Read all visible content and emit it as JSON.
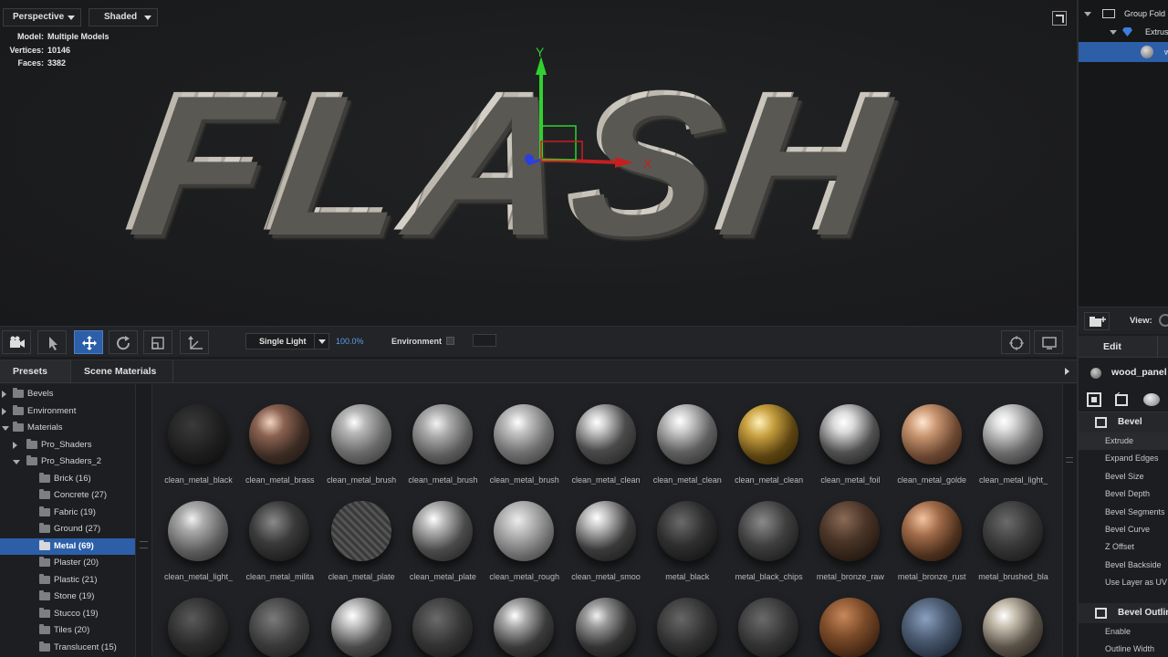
{
  "viewport": {
    "camera_mode": "Perspective",
    "shading_mode": "Shaded",
    "stats": [
      {
        "key": "Model:",
        "value": "Multiple Models"
      },
      {
        "key": "Vertices:",
        "value": "10146"
      },
      {
        "key": "Faces:",
        "value": "3382"
      }
    ],
    "model_text": "FLASH",
    "gizmo": {
      "y_label": "Y",
      "x_label": "X"
    }
  },
  "toolbar": {
    "light_mode": "Single Light",
    "light_intensity": "100.0%",
    "environment_label": "Environment",
    "tools": [
      "camera-icon",
      "select-arrow-icon",
      "move-icon",
      "rotate-icon",
      "scale-icon",
      "axis-icon"
    ],
    "active_tool": "move-icon"
  },
  "presets": {
    "tabs": [
      "Presets",
      "Scene Materials"
    ],
    "tree": [
      {
        "label": "Bevels",
        "level": 0,
        "arrow": "right"
      },
      {
        "label": "Environment",
        "level": 0,
        "arrow": "right"
      },
      {
        "label": "Materials",
        "level": 0,
        "arrow": "down"
      },
      {
        "label": "Pro_Shaders",
        "level": 1,
        "arrow": "right"
      },
      {
        "label": "Pro_Shaders_2",
        "level": 1,
        "arrow": "down"
      },
      {
        "label": "Brick (16)",
        "level": 2
      },
      {
        "label": "Concrete (27)",
        "level": 2
      },
      {
        "label": "Fabric (19)",
        "level": 2
      },
      {
        "label": "Ground (27)",
        "level": 2
      },
      {
        "label": "Metal (69)",
        "level": 2,
        "selected": true
      },
      {
        "label": "Plaster (20)",
        "level": 2
      },
      {
        "label": "Plastic (21)",
        "level": 2
      },
      {
        "label": "Stone (19)",
        "level": 2
      },
      {
        "label": "Stucco (19)",
        "level": 2
      },
      {
        "label": "Tiles (20)",
        "level": 2
      },
      {
        "label": "Translucent (15)",
        "level": 2
      }
    ],
    "materials_row1": [
      "clean_metal_black",
      "clean_metal_brass",
      "clean_metal_brush",
      "clean_metal_brush",
      "clean_metal_brush",
      "clean_metal_clean",
      "clean_metal_clean",
      "clean_metal_clean",
      "clean_metal_foil",
      "clean_metal_golde",
      "clean_metal_light_"
    ],
    "materials_row2": [
      "clean_metal_light_",
      "clean_metal_milita",
      "clean_metal_plate",
      "clean_metal_plate",
      "clean_metal_rough",
      "clean_metal_smoo",
      "metal_black",
      "metal_black_chips",
      "metal_bronze_raw",
      "metal_bronze_rust",
      "metal_brushed_bla"
    ]
  },
  "scene": {
    "rows": [
      {
        "label": "Group Fold",
        "indent": 1
      },
      {
        "label": "Extrus",
        "indent": 2
      },
      {
        "label": "w",
        "indent": 3,
        "selected": true
      }
    ],
    "view_label": "View:",
    "edit_tab": "Edit",
    "material_name": "wood_panel",
    "sections": [
      {
        "title": "Bevel",
        "props": [
          "Extrude",
          "Expand Edges",
          "Bevel Size",
          "Bevel Depth",
          "Bevel Segments",
          "Bevel Curve",
          "Z Offset",
          "Bevel Backside",
          "Use Layer as UV"
        ]
      },
      {
        "title": "Bevel Outline",
        "props": [
          "Enable",
          "Outline Width"
        ]
      }
    ]
  },
  "colors": {
    "accent": "#2c5fa8",
    "intensity_text": "#5c9ee8"
  }
}
